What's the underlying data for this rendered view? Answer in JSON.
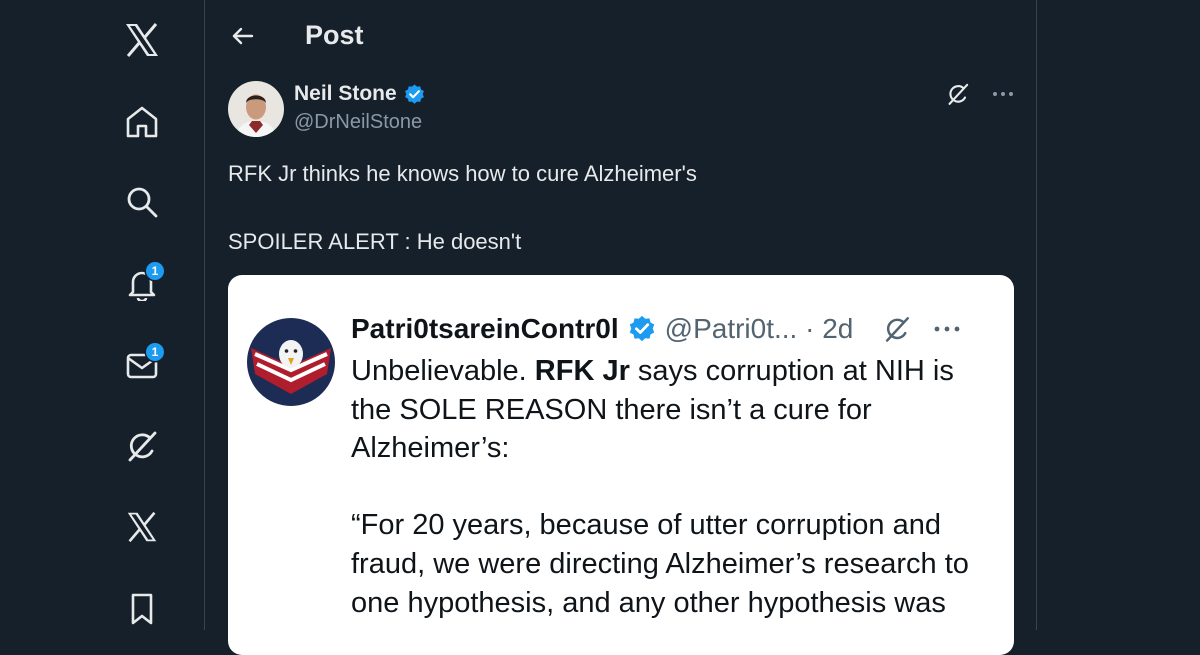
{
  "header": {
    "title": "Post"
  },
  "nav": {
    "notifications_badge": "1",
    "messages_badge": "1"
  },
  "post": {
    "author_name": "Neil Stone",
    "author_handle": "@DrNeilStone",
    "text_line1": "RFK Jr thinks he knows how to cure Alzheimer's",
    "text_line2": "SPOILER ALERT : He doesn't"
  },
  "quote": {
    "author_name": "Patri0tsareinContr0l",
    "author_handle": "@Patri0t... · 2d",
    "body_pre": "Unbelievable. ",
    "body_bold": "RFK Jr",
    "body_post": " says corruption at NIH is the SOLE REASON there isn’t a cure for Alzheimer’s:",
    "body_quote": "“For 20 years, because of utter corruption and fraud, we were directing Alzheimer’s research to one hypothesis, and any other hypothesis was"
  },
  "colors": {
    "background": "#15202b",
    "accent": "#1d9bf0",
    "verified": "#1d9bf0",
    "text_primary": "#e7e9ea",
    "text_secondary": "#8b98a5"
  },
  "icons": {
    "nav": [
      "x-logo-icon",
      "home-icon",
      "search-icon",
      "notifications-bell-icon",
      "messages-envelope-icon",
      "grok-icon",
      "x-premium-icon",
      "bookmark-icon"
    ],
    "header": [
      "back-arrow-icon"
    ],
    "post": [
      "verified-badge-icon",
      "grok-icon",
      "more-options-icon"
    ]
  }
}
